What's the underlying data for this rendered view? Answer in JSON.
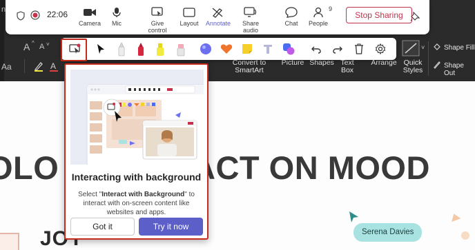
{
  "ribbon": {
    "font_size_up": "A",
    "font_size_down": "A",
    "clear_format": "Aa",
    "convert_label": "Convert to",
    "convert_label2": "SmartArt",
    "picture_label": "Picture",
    "shapes_label": "Shapes",
    "textbox_label": "Text",
    "textbox_label2": "Box",
    "arrange_label": "Arrange",
    "quick_styles_label": "Quick",
    "quick_styles_label2": "Styles",
    "shape_fill_label": "Shape Fill",
    "shape_outline_label": "Shape Out",
    "partial_left_label": "nc"
  },
  "slide": {
    "title_part_a": "OLO",
    "title_part_b": "ACT ON MOOD",
    "subtitle_partial": "JOY",
    "cursor_name": "Serena Davies"
  },
  "teams_bar": {
    "timer": "22:06",
    "camera": "Camera",
    "mic": "Mic",
    "give_control": "Give control",
    "layout": "Layout",
    "annotate": "Annotate",
    "share_audio": "Share audio",
    "chat": "Chat",
    "people": "People",
    "people_count": "9",
    "stop_sharing": "Stop Sharing"
  },
  "annotation_tools": [
    "interact-with-background",
    "select",
    "pen-white",
    "pen-red",
    "highlighter-yellow",
    "eraser",
    "bubble",
    "heart",
    "sticky-note",
    "text",
    "shapes",
    "undo",
    "redo",
    "delete",
    "settings"
  ],
  "popup": {
    "title": "Interacting with background",
    "desc_pre": "Select \"",
    "desc_bold": "Interact with Background",
    "desc_post": "\" to interact with on-screen content like websites and apps.",
    "got_it": "Got it",
    "try_it": "Try it now"
  },
  "colors": {
    "accent": "#5b5fc7",
    "stop": "#c4314b",
    "highlight_box": "#c42b1c",
    "cursor_tag": "#a8e2e1"
  }
}
